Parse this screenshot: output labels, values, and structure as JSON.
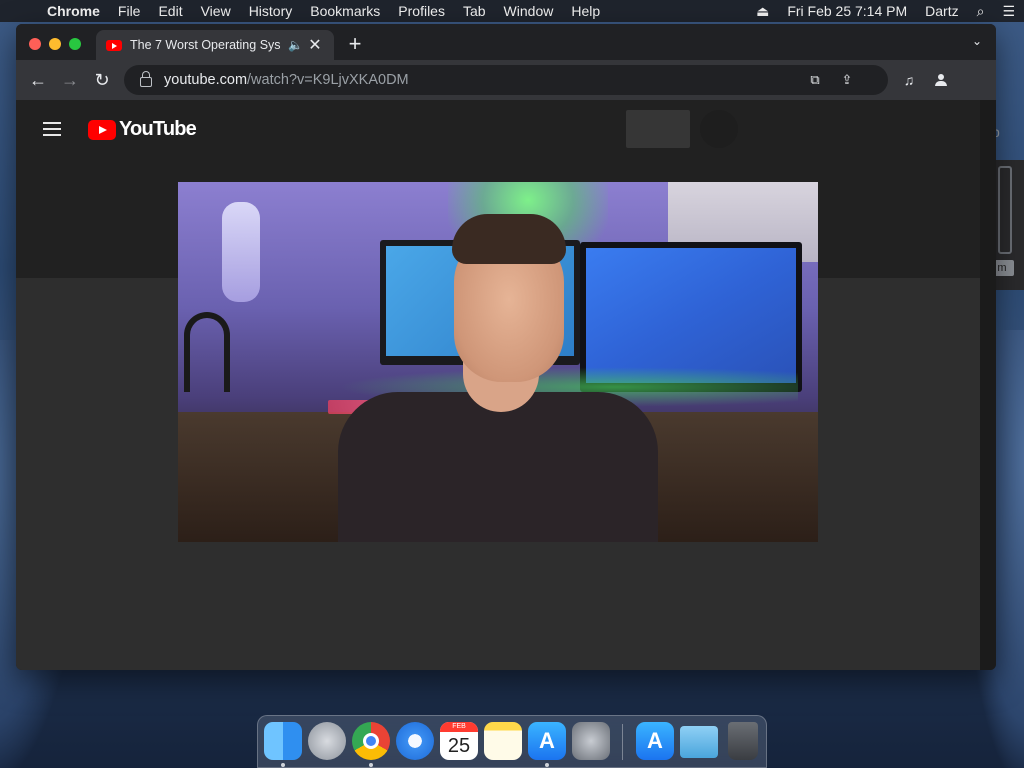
{
  "menubar": {
    "apple": "",
    "items": [
      "Chrome",
      "File",
      "Edit",
      "View",
      "History",
      "Bookmarks",
      "Profiles",
      "Tab",
      "Window",
      "Help"
    ],
    "eject": "⏏",
    "clock": "Fri Feb 25  7:14 PM",
    "user": "Dartz",
    "search": "⌕",
    "control_center": "☰"
  },
  "browser": {
    "tab": {
      "title": "The 7 Worst Operating Sys",
      "audio": "🔈",
      "close": "✕"
    },
    "new_tab": "+",
    "tab_search": "⌄",
    "nav": {
      "back": "←",
      "forward": "→",
      "reload": "↻"
    },
    "omnibox": {
      "host": "youtube.com",
      "path": "/watch?v=K9LjvXKA0DM"
    },
    "icons": {
      "open_in_app": "⧉",
      "share": "⇪",
      "media": "♫"
    }
  },
  "youtube": {
    "logo_text": "YouTube"
  },
  "desktop_behind": {
    "text": "p",
    "tag": "m"
  },
  "dock": {
    "calendar_month": "FEB",
    "calendar_day": "25",
    "app_store_glyph": "A"
  },
  "colors": {
    "tab_bg": "#35363a",
    "window_bg": "#202124",
    "youtube_red": "#ff0000"
  }
}
